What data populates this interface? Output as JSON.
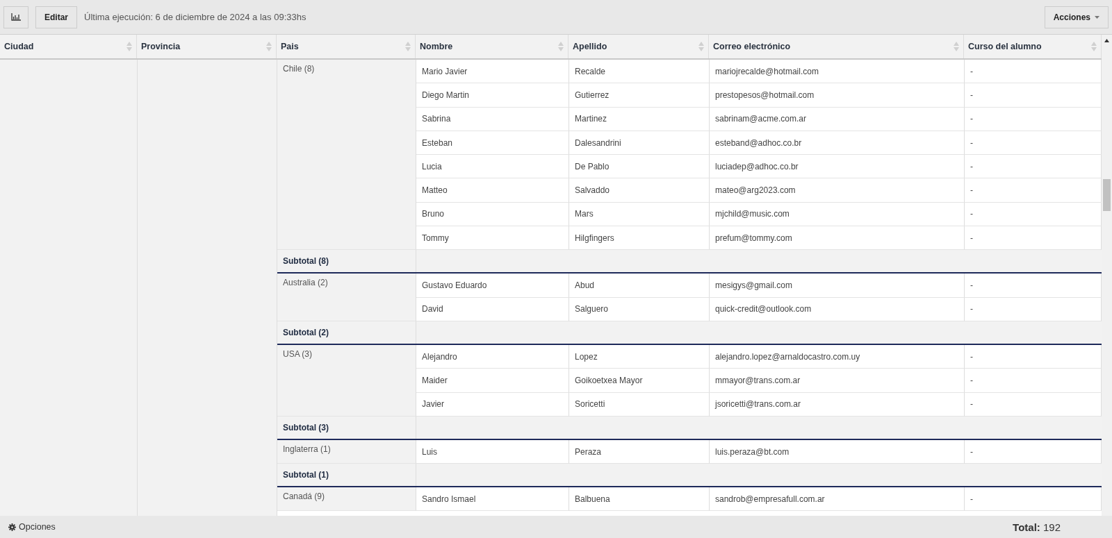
{
  "toolbar": {
    "edit_button": "Editar",
    "last_run": "Última ejecución: 6 de diciembre de 2024 a las 09:33hs",
    "actions_button": "Acciones"
  },
  "table": {
    "columns": [
      "Ciudad",
      "Provincia",
      "Pais",
      "Nombre",
      "Apellido",
      "Correo electrónico",
      "Curso del alumno"
    ],
    "groups": [
      {
        "label": "Chile (8)",
        "subtotal": "Subtotal (8)",
        "rows": [
          {
            "nombre": "Mario Javier",
            "apellido": "Recalde",
            "correo": "mariojrecalde@hotmail.com",
            "curso": "-"
          },
          {
            "nombre": "Diego Martin",
            "apellido": "Gutierrez",
            "correo": "prestopesos@hotmail.com",
            "curso": "-"
          },
          {
            "nombre": "Sabrina",
            "apellido": "Martinez",
            "correo": "sabrinam@acme.com.ar",
            "curso": "-"
          },
          {
            "nombre": "Esteban",
            "apellido": "Dalesandrini",
            "correo": "esteband@adhoc.co.br",
            "curso": "-"
          },
          {
            "nombre": "Lucia",
            "apellido": "De Pablo",
            "correo": "luciadep@adhoc.co.br",
            "curso": "-"
          },
          {
            "nombre": "Matteo",
            "apellido": "Salvaddo",
            "correo": "mateo@arg2023.com",
            "curso": "-"
          },
          {
            "nombre": "Bruno",
            "apellido": "Mars",
            "correo": "mjchild@music.com",
            "curso": "-"
          },
          {
            "nombre": "Tommy",
            "apellido": "Hilgfingers",
            "correo": "prefum@tommy.com",
            "curso": "-"
          }
        ]
      },
      {
        "label": "Australia (2)",
        "subtotal": "Subtotal (2)",
        "rows": [
          {
            "nombre": "Gustavo Eduardo",
            "apellido": "Abud",
            "correo": "mesigys@gmail.com",
            "curso": "-"
          },
          {
            "nombre": "David",
            "apellido": "Salguero",
            "correo": "quick-credit@outlook.com",
            "curso": "-"
          }
        ]
      },
      {
        "label": "USA (3)",
        "subtotal": "Subtotal (3)",
        "rows": [
          {
            "nombre": "Alejandro",
            "apellido": "Lopez",
            "correo": "alejandro.lopez@arnaldocastro.com.uy",
            "curso": "-"
          },
          {
            "nombre": "Maider",
            "apellido": "Goikoetxea Mayor",
            "correo": "mmayor@trans.com.ar",
            "curso": "-"
          },
          {
            "nombre": "Javier",
            "apellido": "Soricetti",
            "correo": "jsoricetti@trans.com.ar",
            "curso": "-"
          }
        ]
      },
      {
        "label": "Inglaterra (1)",
        "subtotal": "Subtotal (1)",
        "rows": [
          {
            "nombre": "Luis",
            "apellido": "Peraza",
            "correo": "luis.peraza@bt.com",
            "curso": "-"
          }
        ]
      },
      {
        "label": "Canadá (9)",
        "rows": [
          {
            "nombre": "Sandro Ismael",
            "apellido": "Balbuena",
            "correo": "sandrob@empresafull.com.ar",
            "curso": "-"
          }
        ]
      }
    ]
  },
  "footer": {
    "options": "Opciones",
    "total_label": "Total:",
    "total_value": "192"
  }
}
